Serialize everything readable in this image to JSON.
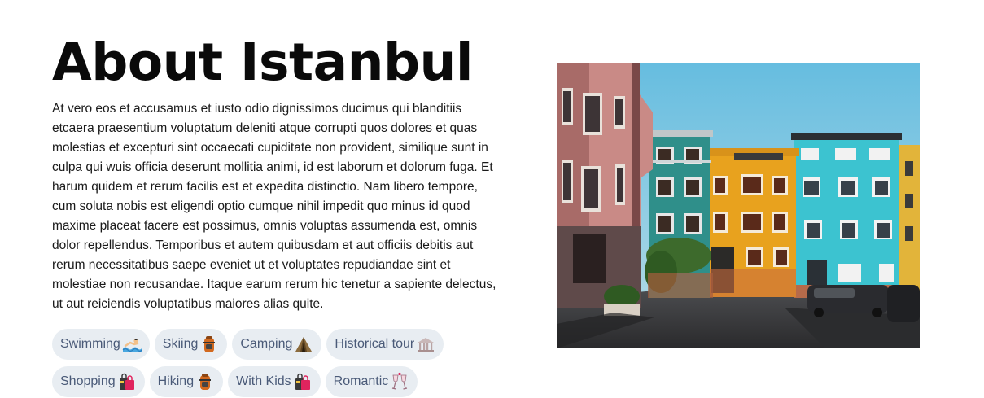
{
  "heading": "About Istanbul",
  "paragraph": "At vero eos et accusamus et iusto odio dignissimos ducimus qui blanditiis etcaera praesentium voluptatum deleniti atque corrupti quos dolores et quas molestias et excepturi sint occaecati cupiditate non provident, similique sunt in culpa qui wuis officia deserunt mollitia animi, id est laborum et dolorum fuga. Et harum quidem et rerum facilis est et expedita distinctio. Nam libero tempore, cum soluta nobis est eligendi optio cumque nihil impedit quo minus id quod maxime placeat facere est possimus, omnis voluptas assumenda est, omnis dolor repellendus. Temporibus et autem quibusdam et aut officiis debitis aut rerum necessitatibus saepe eveniet ut et voluptates repudiandae sint et molestiae non recusandae. Itaque earum rerum hic tenetur a sapiente delectus, ut aut reiciendis voluptatibus maiores alias quite.",
  "tags": [
    {
      "label": "Swimming",
      "icon": "swimmer-icon"
    },
    {
      "label": "Skiing",
      "icon": "backpack-icon"
    },
    {
      "label": "Camping",
      "icon": "tent-icon"
    },
    {
      "label": "Historical tour",
      "icon": "ruins-icon"
    },
    {
      "label": "Shopping",
      "icon": "shopping-bags-icon"
    },
    {
      "label": "Hiking",
      "icon": "backpack-icon"
    },
    {
      "label": "With Kids",
      "icon": "shopping-bags-icon"
    },
    {
      "label": "Romantic",
      "icon": "clinking-glasses-icon"
    }
  ],
  "photo": {
    "subject": "Colorful houses on a cobblestone street",
    "colors": {
      "sky": "#5eb3d6",
      "pink_building": "#c98a86",
      "teal_building": "#2f8f8a",
      "orange_building": "#e8a21e",
      "turquoise_building": "#3cc3d0",
      "yellow_building": "#e2b43a",
      "street": "#3a3a3c"
    }
  },
  "colors": {
    "tag_bg": "#e8edf2",
    "tag_text": "#4a5a78",
    "heading": "#0a0a0a"
  }
}
